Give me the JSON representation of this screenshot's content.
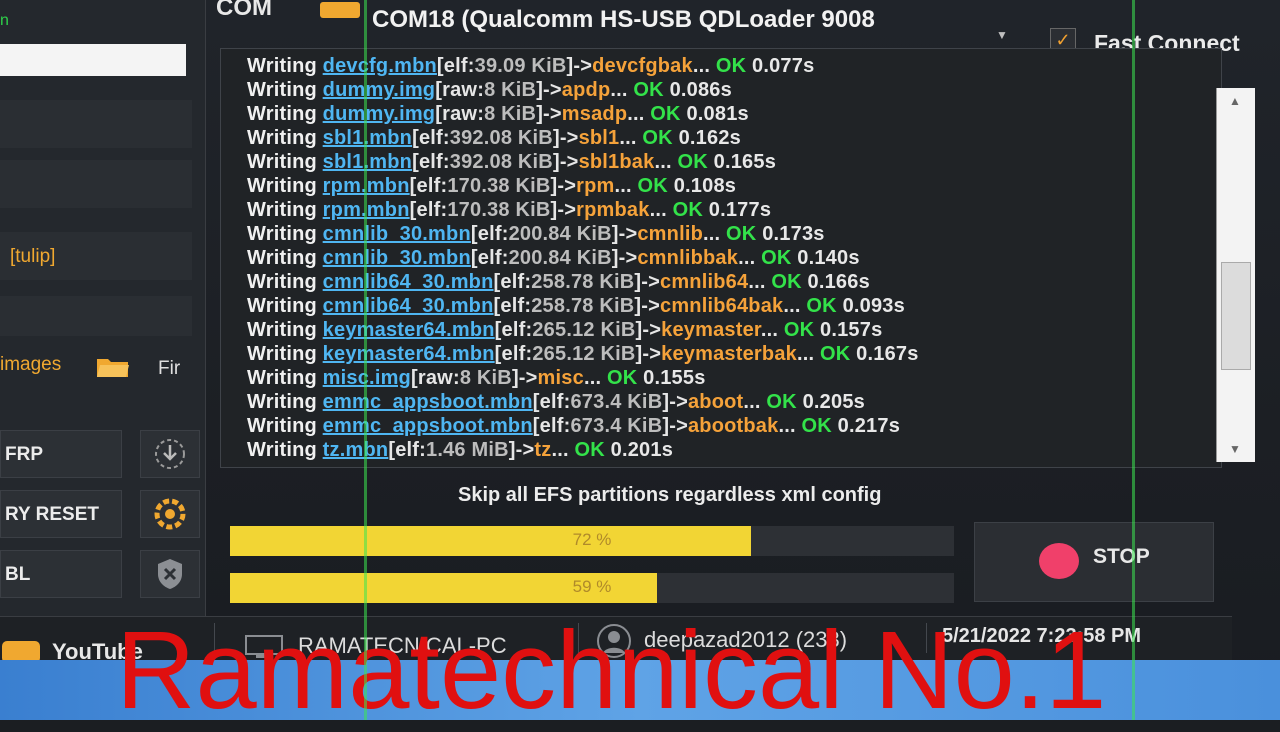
{
  "header": {
    "com_label": "COM",
    "port": "COM18 (Qualcomm HS-USB QDLoader 9008",
    "fast_connect_label": "Fast Connect",
    "fast_connect_checked": true
  },
  "left_panel": {
    "top_text": "n",
    "device": "[tulip]",
    "images_label": "images",
    "firmware_label": "Fir",
    "buttons": [
      {
        "label": "FRP",
        "icon": "download-icon"
      },
      {
        "label": "RY RESET",
        "icon": "gear-icon"
      },
      {
        "label": "BL",
        "icon": "shield-icon"
      }
    ]
  },
  "log": {
    "lines": [
      {
        "w": "Writing",
        "file": "devcfg.mbn",
        "type": "elf",
        "size": "39.09 KiB",
        "part": "devcfgbak",
        "ok": "OK",
        "time": "0.077s"
      },
      {
        "w": "Writing",
        "file": "dummy.img",
        "type": "raw",
        "size": "8 KiB",
        "part": "apdp",
        "ok": "OK",
        "time": "0.086s"
      },
      {
        "w": "Writing",
        "file": "dummy.img",
        "type": "raw",
        "size": "8 KiB",
        "part": "msadp",
        "ok": "OK",
        "time": "0.081s"
      },
      {
        "w": "Writing",
        "file": "sbl1.mbn",
        "type": "elf",
        "size": "392.08 KiB",
        "part": "sbl1",
        "ok": "OK",
        "time": "0.162s"
      },
      {
        "w": "Writing",
        "file": "sbl1.mbn",
        "type": "elf",
        "size": "392.08 KiB",
        "part": "sbl1bak",
        "ok": "OK",
        "time": "0.165s"
      },
      {
        "w": "Writing",
        "file": "rpm.mbn",
        "type": "elf",
        "size": "170.38 KiB",
        "part": "rpm",
        "ok": "OK",
        "time": "0.108s"
      },
      {
        "w": "Writing",
        "file": "rpm.mbn",
        "type": "elf",
        "size": "170.38 KiB",
        "part": "rpmbak",
        "ok": "OK",
        "time": "0.177s"
      },
      {
        "w": "Writing",
        "file": "cmnlib_30.mbn",
        "type": "elf",
        "size": "200.84 KiB",
        "part": "cmnlib",
        "ok": "OK",
        "time": "0.173s"
      },
      {
        "w": "Writing",
        "file": "cmnlib_30.mbn",
        "type": "elf",
        "size": "200.84 KiB",
        "part": "cmnlibbak",
        "ok": "OK",
        "time": "0.140s"
      },
      {
        "w": "Writing",
        "file": "cmnlib64_30.mbn",
        "type": "elf",
        "size": "258.78 KiB",
        "part": "cmnlib64",
        "ok": "OK",
        "time": "0.166s"
      },
      {
        "w": "Writing",
        "file": "cmnlib64_30.mbn",
        "type": "elf",
        "size": "258.78 KiB",
        "part": "cmnlib64bak",
        "ok": "OK",
        "time": "0.093s"
      },
      {
        "w": "Writing",
        "file": "keymaster64.mbn",
        "type": "elf",
        "size": "265.12 KiB",
        "part": "keymaster",
        "ok": "OK",
        "time": "0.157s"
      },
      {
        "w": "Writing",
        "file": "keymaster64.mbn",
        "type": "elf",
        "size": "265.12 KiB",
        "part": "keymasterbak",
        "ok": "OK",
        "time": "0.167s"
      },
      {
        "w": "Writing",
        "file": "misc.img",
        "type": "raw",
        "size": "8 KiB",
        "part": "misc",
        "ok": "OK",
        "time": "0.155s"
      },
      {
        "w": "Writing",
        "file": "emmc_appsboot.mbn",
        "type": "elf",
        "size": "673.4 KiB",
        "part": "aboot",
        "ok": "OK",
        "time": "0.205s"
      },
      {
        "w": "Writing",
        "file": "emmc_appsboot.mbn",
        "type": "elf",
        "size": "673.4 KiB",
        "part": "abootbak",
        "ok": "OK",
        "time": "0.217s"
      },
      {
        "w": "Writing",
        "file": "tz.mbn",
        "type": "elf",
        "size": "1.46 MiB",
        "part": "tz",
        "ok": "OK",
        "time": "0.201s"
      }
    ]
  },
  "status": {
    "message": "Skip all EFS partitions regardless xml config",
    "progress1": {
      "value": 72,
      "label": "72 %"
    },
    "progress2": {
      "value": 59,
      "label": "59 %"
    },
    "stop_label": "STOP"
  },
  "statusbar": {
    "youtube": "YouTube",
    "pc_name": "RAMATECNICAL-PC",
    "user": "deepazad2012 (233)",
    "datetime": "5/21/2022 7:23:58 PM"
  },
  "watermark": "Ramatechnical No.1",
  "colors": {
    "accent": "#f0a830",
    "ok": "#33e24a",
    "file": "#4fb6f2",
    "progress": "#f2d534",
    "stop": "#f0406a"
  }
}
